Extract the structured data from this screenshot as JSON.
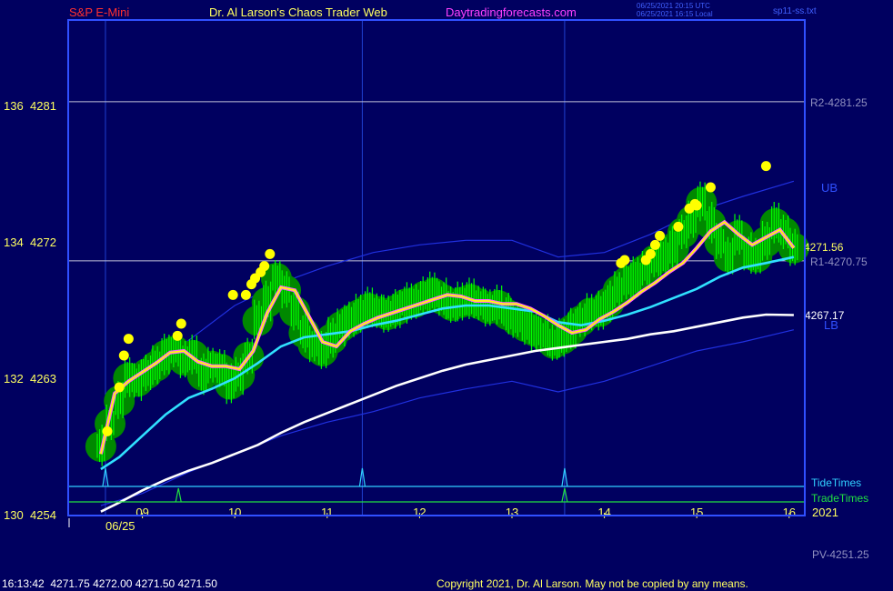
{
  "header": {
    "symbol": "S&P E-Mini",
    "site_title": "Dr. Al Larson's Chaos Trader Web",
    "site_url": "Daytradingforecasts.com",
    "timestamp_utc": "06/25/2021 20:15 UTC",
    "timestamp_local": "06/25/2021 16:15 Local",
    "file_name": "sp11-ss.txt"
  },
  "footer": {
    "quote": "16:13:42  4271.75 4272.00 4271.50 4271.50",
    "copyright": "Copyright 2021, Dr. Al Larson. May not be copied by any means."
  },
  "colors": {
    "background": "#000060",
    "frame": "#3050ff",
    "price": "#00ff00",
    "glow": "#008800",
    "yellow_line": "#ffff00",
    "magenta_line": "#ff60ff",
    "cyan_line": "#30e0ff",
    "white_line": "#ffffff",
    "band": "#2030e0",
    "tide": "#30d0ff",
    "trade": "#20e040",
    "title_red": "#ff3030",
    "site_magenta": "#ff40ff"
  },
  "chart_data": {
    "type": "line",
    "x_unit": "hour",
    "x_ticks": [
      "09",
      "10",
      "11",
      "12",
      "13",
      "14",
      "15",
      "16"
    ],
    "date_label": "06/25",
    "year_label": "2021",
    "ylim": [
      4254,
      4284
    ],
    "y_ticks": [
      {
        "left": "130",
        "value": 4254,
        "label": "4254"
      },
      {
        "left": "132",
        "value": 4263,
        "label": "4263"
      },
      {
        "left": "134",
        "value": 4272,
        "label": "4272"
      },
      {
        "left": "136",
        "value": 4281,
        "label": "4281"
      }
    ],
    "levels": [
      {
        "name": "R2",
        "label": "R2-4281.25",
        "value": 4281.25
      },
      {
        "name": "R1",
        "label": "R1-4270.75",
        "value": 4270.75
      },
      {
        "name": "PV",
        "label": "PV-4251.25",
        "value": 4251.25
      }
    ],
    "right_labels": {
      "ub": "UB",
      "lb": "LB",
      "last_price": "4271.56",
      "white_last": "4267.17",
      "tide": "TideTimes",
      "trade": "TradeTimes"
    },
    "series": [
      {
        "name": "price",
        "color": "#00ff00",
        "x": [
          8.55,
          8.65,
          8.75,
          8.85,
          8.95,
          9.05,
          9.15,
          9.25,
          9.35,
          9.45,
          9.55,
          9.65,
          9.75,
          9.85,
          9.95,
          10.05,
          10.15,
          10.25,
          10.35,
          10.45,
          10.55,
          10.65,
          10.75,
          10.85,
          10.95,
          11.05,
          11.15,
          11.25,
          11.35,
          11.45,
          11.55,
          11.65,
          11.75,
          11.85,
          11.95,
          12.05,
          12.15,
          12.25,
          12.35,
          12.45,
          12.55,
          12.65,
          12.75,
          12.85,
          12.95,
          13.05,
          13.15,
          13.25,
          13.35,
          13.45,
          13.55,
          13.65,
          13.75,
          13.85,
          13.95,
          14.05,
          14.15,
          14.25,
          14.35,
          14.45,
          14.55,
          14.65,
          14.75,
          14.85,
          14.95,
          15.05,
          15.15,
          15.25,
          15.35,
          15.45,
          15.55,
          15.65,
          15.75,
          15.85,
          15.95,
          16.05
        ],
        "y": [
          4258.5,
          4260.0,
          4261.5,
          4263.0,
          4262.8,
          4263.3,
          4263.8,
          4264.5,
          4264.8,
          4264.2,
          4264.5,
          4263.2,
          4263.8,
          4263.6,
          4262.6,
          4263.2,
          4264.4,
          4266.8,
          4268.0,
          4269.6,
          4268.8,
          4267.4,
          4266.0,
          4265.2,
          4264.8,
          4265.6,
          4266.4,
          4266.8,
          4267.2,
          4267.6,
          4267.4,
          4267.2,
          4267.5,
          4267.9,
          4268.0,
          4268.4,
          4268.6,
          4268.2,
          4267.8,
          4268.0,
          4268.2,
          4267.9,
          4267.6,
          4267.8,
          4267.2,
          4266.8,
          4266.4,
          4266.1,
          4265.8,
          4265.3,
          4265.6,
          4266.2,
          4266.8,
          4267.3,
          4267.4,
          4268.0,
          4268.8,
          4269.4,
          4269.6,
          4270.2,
          4270.8,
          4271.0,
          4271.6,
          4272.6,
          4273.4,
          4274.6,
          4273.2,
          4272.0,
          4271.0,
          4272.4,
          4271.2,
          4271.0,
          4272.0,
          4273.2,
          4272.6,
          4271.6
        ]
      },
      {
        "name": "yellow",
        "color": "#ffff00",
        "x": [
          8.55,
          8.7,
          8.85,
          9.0,
          9.15,
          9.3,
          9.45,
          9.6,
          9.75,
          9.9,
          10.05,
          10.2,
          10.35,
          10.5,
          10.65,
          10.8,
          10.95,
          11.1,
          11.25,
          11.4,
          11.55,
          11.7,
          11.85,
          12.0,
          12.15,
          12.3,
          12.45,
          12.6,
          12.75,
          12.9,
          13.05,
          13.2,
          13.35,
          13.5,
          13.65,
          13.8,
          13.95,
          14.1,
          14.25,
          14.4,
          14.55,
          14.7,
          14.85,
          15.0,
          15.15,
          15.3,
          15.45,
          15.6,
          15.75,
          15.9,
          16.05
        ],
        "y": [
          4258.0,
          4262.0,
          4262.8,
          4263.4,
          4264.0,
          4264.7,
          4264.8,
          4264.1,
          4263.8,
          4263.8,
          4263.6,
          4264.8,
          4267.3,
          4269.0,
          4268.8,
          4267.1,
          4265.4,
          4265.1,
          4266.1,
          4266.6,
          4267.0,
          4267.3,
          4267.6,
          4267.9,
          4268.2,
          4268.5,
          4268.4,
          4268.1,
          4268.1,
          4267.9,
          4267.9,
          4267.6,
          4267.1,
          4266.5,
          4266.0,
          4266.2,
          4266.9,
          4267.4,
          4268.0,
          4268.7,
          4269.3,
          4270.0,
          4270.6,
          4271.6,
          4272.7,
          4273.3,
          4272.5,
          4271.8,
          4272.3,
          4272.8,
          4271.6
        ]
      },
      {
        "name": "cyan",
        "color": "#30e0ff",
        "x": [
          8.55,
          8.75,
          9.0,
          9.25,
          9.5,
          9.75,
          10.0,
          10.25,
          10.5,
          10.75,
          11.0,
          11.25,
          11.5,
          11.75,
          12.0,
          12.25,
          12.5,
          12.75,
          13.0,
          13.25,
          13.5,
          13.75,
          14.0,
          14.25,
          14.5,
          14.75,
          15.0,
          15.25,
          15.5,
          15.75,
          16.05
        ],
        "y": [
          4257.0,
          4257.8,
          4259.2,
          4260.6,
          4261.7,
          4262.3,
          4263.0,
          4264.0,
          4265.1,
          4265.7,
          4265.9,
          4266.1,
          4266.5,
          4266.8,
          4267.2,
          4267.6,
          4267.8,
          4267.8,
          4267.6,
          4267.4,
          4266.7,
          4266.5,
          4266.8,
          4267.2,
          4267.7,
          4268.3,
          4268.9,
          4269.7,
          4270.3,
          4270.6,
          4271.0
        ]
      },
      {
        "name": "white",
        "color": "#ffffff",
        "x": [
          8.55,
          8.75,
          9.0,
          9.25,
          9.5,
          9.75,
          10.0,
          10.25,
          10.5,
          10.75,
          11.0,
          11.25,
          11.5,
          11.75,
          12.0,
          12.25,
          12.5,
          12.75,
          13.0,
          13.25,
          13.5,
          13.75,
          14.0,
          14.25,
          14.5,
          14.75,
          15.0,
          15.25,
          15.5,
          15.75,
          16.05
        ],
        "y": [
          4254.2,
          4254.8,
          4255.6,
          4256.3,
          4256.9,
          4257.4,
          4258.0,
          4258.6,
          4259.4,
          4260.1,
          4260.7,
          4261.3,
          4261.9,
          4262.5,
          4263.0,
          4263.5,
          4263.9,
          4264.2,
          4264.5,
          4264.8,
          4265.0,
          4265.2,
          4265.4,
          4265.6,
          4265.9,
          4266.1,
          4266.4,
          4266.7,
          4267.0,
          4267.2,
          4267.17
        ]
      },
      {
        "name": "UB",
        "color": "#2030e0",
        "x": [
          8.55,
          9.0,
          9.5,
          10.0,
          10.5,
          11.0,
          11.5,
          12.0,
          12.5,
          13.0,
          13.5,
          14.0,
          14.5,
          15.0,
          15.5,
          16.05
        ],
        "y": [
          4259.5,
          4262.8,
          4265.5,
          4267.8,
          4269.3,
          4270.4,
          4271.3,
          4271.8,
          4272.1,
          4272.1,
          4271.0,
          4271.3,
          4272.5,
          4274.0,
          4275.0,
          4276.0
        ]
      },
      {
        "name": "LB",
        "color": "#2030e0",
        "x": [
          8.55,
          9.0,
          9.5,
          10.0,
          10.5,
          11.0,
          11.5,
          12.0,
          12.5,
          13.0,
          13.5,
          14.0,
          14.5,
          15.0,
          15.5,
          16.05
        ],
        "y": [
          4254.6,
          4255.4,
          4256.8,
          4258.0,
          4259.2,
          4260.1,
          4260.8,
          4261.7,
          4262.3,
          4262.8,
          4262.1,
          4262.8,
          4263.8,
          4264.8,
          4265.4,
          4266.2
        ]
      }
    ],
    "peaks": {
      "x": [
        8.62,
        8.75,
        8.8,
        8.85,
        9.38,
        9.42,
        9.98,
        10.12,
        10.18,
        10.22,
        10.28,
        10.32,
        10.38,
        14.18,
        14.22,
        14.45,
        14.5,
        14.55,
        14.6,
        14.8,
        14.92,
        14.98,
        15.0,
        15.15,
        15.75
      ],
      "y": [
        4259.5,
        4262.4,
        4264.5,
        4265.6,
        4265.8,
        4266.6,
        4268.5,
        4268.5,
        4269.2,
        4269.6,
        4270.0,
        4270.4,
        4271.2,
        4270.6,
        4270.8,
        4270.8,
        4271.2,
        4271.8,
        4272.4,
        4273.0,
        4274.2,
        4274.5,
        4274.4,
        4275.6,
        4277.0
      ]
    },
    "tide_times": [
      8.6,
      11.38,
      13.57
    ],
    "trade_times": [
      9.39,
      13.57
    ]
  }
}
